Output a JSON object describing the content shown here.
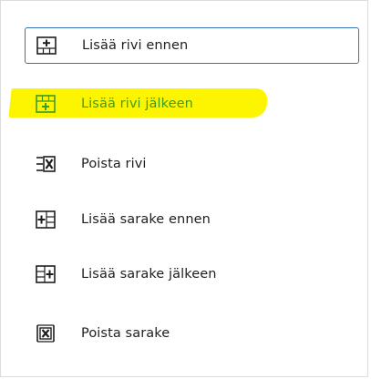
{
  "colors": {
    "focus_border": "#3a74b8",
    "highlight": "#fdf400",
    "highlight_text": "#3f9b1c",
    "text": "#1e1e1e"
  },
  "menu": {
    "items": [
      {
        "label": "Lisää rivi ennen",
        "icon": "insert-row-before-icon",
        "focused": true,
        "highlighted": false
      },
      {
        "label": "Lisää rivi jälkeen",
        "icon": "insert-row-after-icon",
        "focused": false,
        "highlighted": true
      },
      {
        "label": "Poista rivi",
        "icon": "delete-row-icon",
        "focused": false,
        "highlighted": false
      },
      {
        "label": "Lisää sarake ennen",
        "icon": "insert-column-before-icon",
        "focused": false,
        "highlighted": false
      },
      {
        "label": "Lisää sarake jälkeen",
        "icon": "insert-column-after-icon",
        "focused": false,
        "highlighted": false
      },
      {
        "label": "Poista sarake",
        "icon": "delete-column-icon",
        "focused": false,
        "highlighted": false
      }
    ]
  }
}
